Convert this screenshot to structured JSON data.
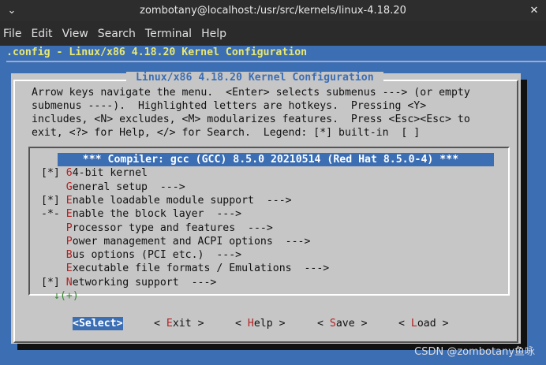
{
  "window": {
    "title": "zombotany@localhost:/usr/src/kernels/linux-4.18.20",
    "minimize_glyph": "⌄",
    "close_glyph": "✕"
  },
  "menubar": {
    "items": [
      "File",
      "Edit",
      "View",
      "Search",
      "Terminal",
      "Help"
    ]
  },
  "terminal": {
    "config_header": ".config - Linux/x86 4.18.20 Kernel Configuration"
  },
  "dialog": {
    "title": " Linux/x86 4.18.20 Kernel Configuration ",
    "help_lines": [
      "Arrow keys navigate the menu.  <Enter> selects submenus ---> (or empty",
      "submenus ----).  Highlighted letters are hotkeys.  Pressing <Y>",
      "includes, <N> excludes, <M> modularizes features.  Press <Esc><Esc> to",
      "exit, <?> for Help, </> for Search.  Legend: [*] built-in  [ ]"
    ],
    "more_indicator": "↓(+)",
    "menu_items": [
      {
        "prefix": "    ",
        "hotkey": "",
        "rest": "*** Compiler: gcc (GCC) 8.5.0 20210514 (Red Hat 8.5.0-4) ***",
        "selected": true
      },
      {
        "prefix": "[*] ",
        "hotkey": "6",
        "rest": "4-bit kernel",
        "selected": false
      },
      {
        "prefix": "    ",
        "hotkey": "G",
        "rest": "eneral setup  --->",
        "selected": false
      },
      {
        "prefix": "[*] ",
        "hotkey": "E",
        "rest": "nable loadable module support  --->",
        "selected": false
      },
      {
        "prefix": "-*- ",
        "hotkey": "E",
        "rest": "nable the block layer  --->",
        "selected": false
      },
      {
        "prefix": "    ",
        "hotkey": "P",
        "rest": "rocessor type and features  --->",
        "selected": false
      },
      {
        "prefix": "    ",
        "hotkey": "P",
        "rest": "ower management and ACPI options  --->",
        "selected": false
      },
      {
        "prefix": "    ",
        "hotkey": "B",
        "rest": "us options (PCI etc.)  --->",
        "selected": false
      },
      {
        "prefix": "    ",
        "hotkey": "E",
        "rest": "xecutable file formats / Emulations  --->",
        "selected": false
      },
      {
        "prefix": "[*] ",
        "hotkey": "N",
        "rest": "etworking support  --->",
        "selected": false
      }
    ],
    "buttons": [
      {
        "pre": "<",
        "hotkey": "S",
        "post": "elect>",
        "active": true
      },
      {
        "pre": "< ",
        "hotkey": "E",
        "post": "xit >",
        "active": false
      },
      {
        "pre": "< ",
        "hotkey": "H",
        "post": "elp >",
        "active": false
      },
      {
        "pre": "< ",
        "hotkey": "S",
        "post": "ave >",
        "active": false
      },
      {
        "pre": "< ",
        "hotkey": "L",
        "post": "oad >",
        "active": false
      }
    ]
  },
  "watermark": "CSDN @zombotany鱼咏"
}
